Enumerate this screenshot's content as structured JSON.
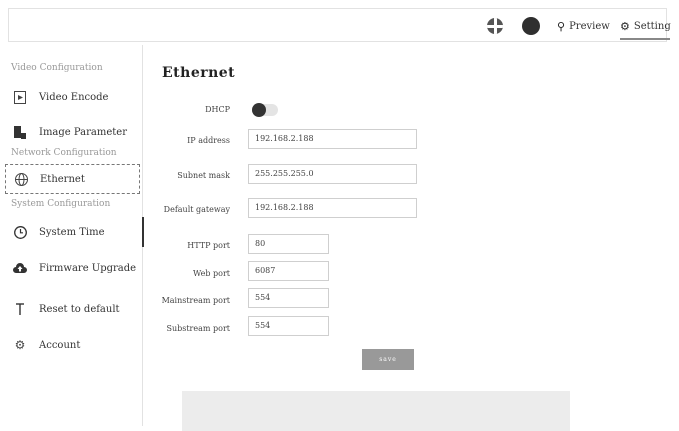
{
  "header": {
    "preview_label": "Preview",
    "setting_label": "Setting"
  },
  "sidebar": {
    "sections": [
      "Video Configuration",
      "Network Configuration",
      "System Configuration"
    ],
    "items": [
      {
        "label": "Video Encode",
        "icon": "video-encode-icon"
      },
      {
        "label": "Image Parameter",
        "icon": "image-parameter-icon"
      },
      {
        "label": "Ethernet",
        "icon": "globe-icon"
      },
      {
        "label": "System Time",
        "icon": "clock-icon"
      },
      {
        "label": "Firmware Upgrade",
        "icon": "cloud-upload-icon"
      },
      {
        "label": "Reset to default",
        "icon": "reset-icon"
      },
      {
        "label": "Account",
        "icon": "gear-icon"
      }
    ]
  },
  "main": {
    "title": "Ethernet",
    "dhcp": {
      "label": "DHCP",
      "enabled": false
    },
    "fields": {
      "ip": {
        "label": "IP address",
        "value": "192.168.2.188"
      },
      "subnet": {
        "label": "Subnet mask",
        "value": "255.255.255.0"
      },
      "gateway": {
        "label": "Default gateway",
        "value": "192.168.2.188"
      },
      "http": {
        "label": "HTTP port",
        "value": "80"
      },
      "web": {
        "label": "Web port",
        "value": "6087"
      },
      "mainstream": {
        "label": "Mainstream port",
        "value": "554"
      },
      "substream": {
        "label": "Substream port",
        "value": "554"
      }
    },
    "save_label": "save"
  }
}
